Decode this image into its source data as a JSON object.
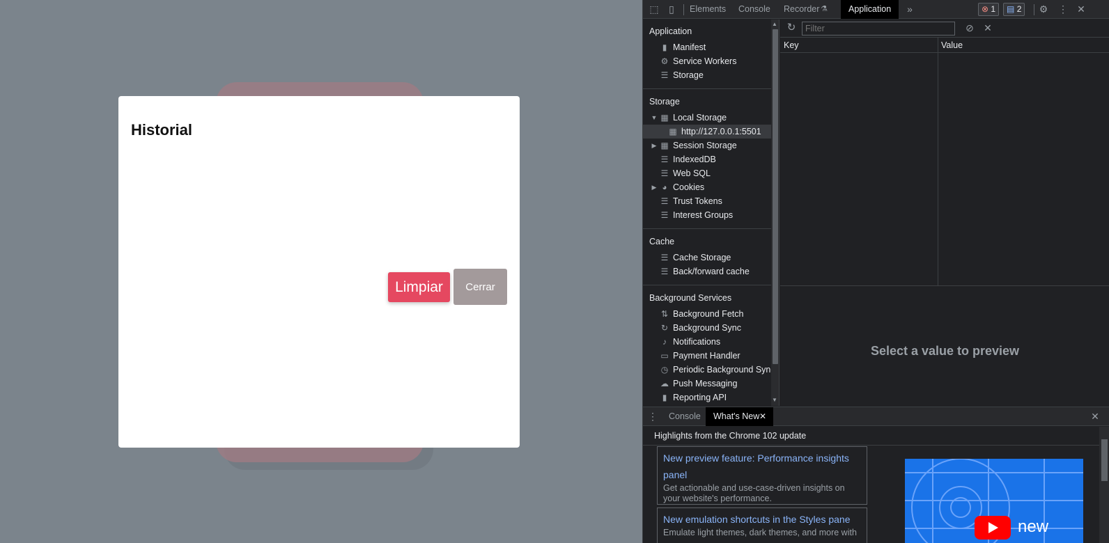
{
  "page": {
    "modal_title": "Historial",
    "limpiar_label": "Limpiar",
    "cerrar_label": "Cerrar"
  },
  "devtools": {
    "tabs": [
      "Elements",
      "Console",
      "Recorder",
      "Application"
    ],
    "active_tab": "Application",
    "error_count": "1",
    "message_count": "2",
    "sidebar": {
      "application_header": "Application",
      "application_items": [
        "Manifest",
        "Service Workers",
        "Storage"
      ],
      "storage_header": "Storage",
      "local_storage": "Local Storage",
      "local_storage_origin": "http://127.0.0.1:5501",
      "storage_items": [
        "Session Storage",
        "IndexedDB",
        "Web SQL",
        "Cookies",
        "Trust Tokens",
        "Interest Groups"
      ],
      "cache_header": "Cache",
      "cache_items": [
        "Cache Storage",
        "Back/forward cache"
      ],
      "bg_header": "Background Services",
      "bg_items": [
        "Background Fetch",
        "Background Sync",
        "Notifications",
        "Payment Handler",
        "Periodic Background Sync",
        "Push Messaging",
        "Reporting API"
      ]
    },
    "main": {
      "filter_placeholder": "Filter",
      "col_key": "Key",
      "col_value": "Value",
      "preview_text": "Select a value to preview"
    },
    "drawer": {
      "tabs": [
        "Console",
        "What's New"
      ],
      "active_tab": "What's New",
      "highlights": "Highlights from the Chrome 102 update",
      "cards": [
        {
          "title": "New preview feature: Performance insights panel",
          "desc": "Get actionable and use-case-driven insights on your website's performance."
        },
        {
          "title": "New emulation shortcuts in the Styles pane",
          "desc": "Emulate light themes, dark themes, and more with"
        }
      ],
      "video_label": "new"
    }
  },
  "colors": {
    "limpiar_bg": "#e54860",
    "cerrar_bg": "#a39a9b",
    "viewport_bg": "#7b848c",
    "link_blue": "#8ab4f8"
  }
}
